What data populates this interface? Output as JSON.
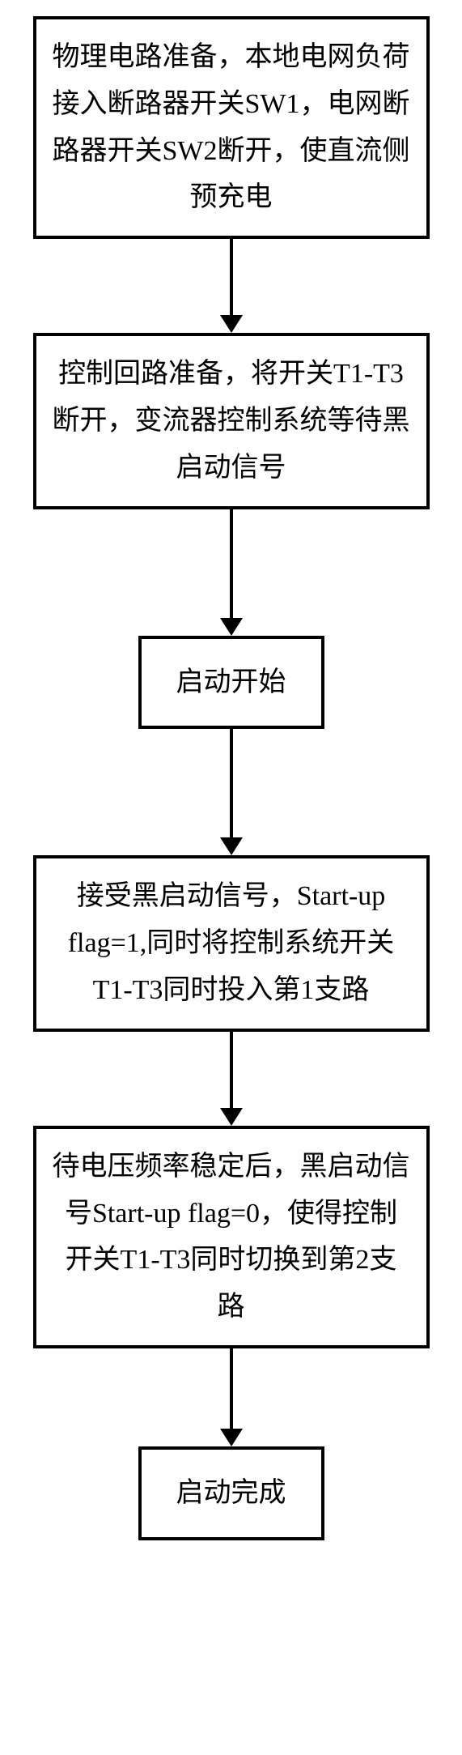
{
  "flow": {
    "steps": [
      {
        "id": "step1",
        "text": "物理电路准备，本地电网负荷接入断路器开关SW1，电网断路器开关SW2断开，使直流侧预充电",
        "size": "large"
      },
      {
        "id": "step2",
        "text": "控制回路准备，将开关T1-T3断开，变流器控制系统等待黑启动信号",
        "size": "large"
      },
      {
        "id": "step3",
        "text": "启动开始",
        "size": "small"
      },
      {
        "id": "step4",
        "text": "接受黑启动信号，Start-up flag=1,同时将控制系统开关T1-T3同时投入第1支路",
        "size": "large"
      },
      {
        "id": "step5",
        "text": "待电压频率稳定后，黑启动信号Start-up flag=0，使得控制开关T1-T3同时切换到第2支路",
        "size": "large"
      },
      {
        "id": "step6",
        "text": "启动完成",
        "size": "small"
      }
    ]
  }
}
